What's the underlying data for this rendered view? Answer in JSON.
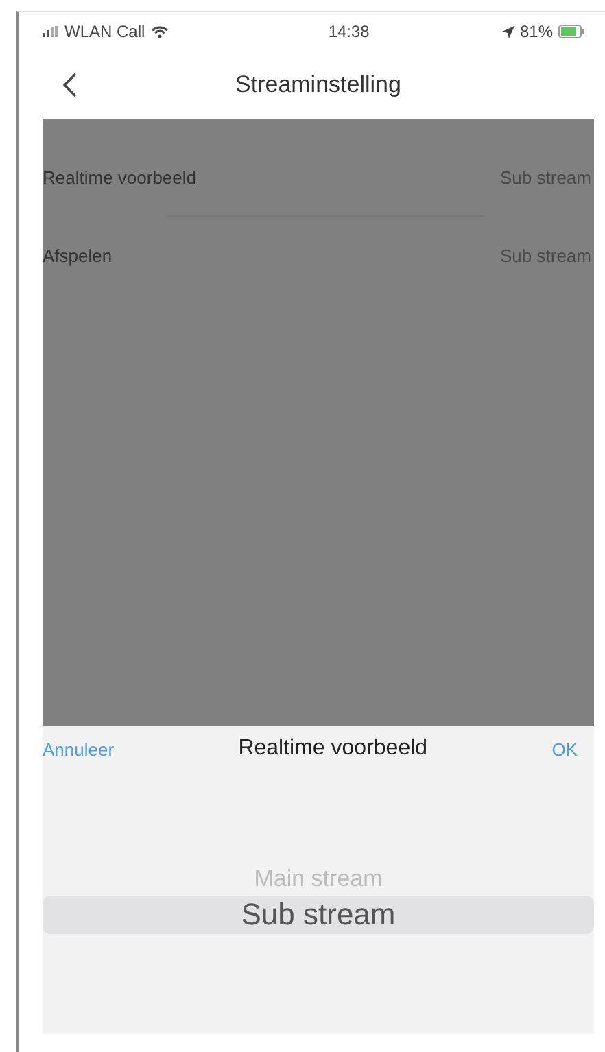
{
  "status_bar": {
    "carrier": "WLAN Call",
    "time": "14:38",
    "battery": "81%"
  },
  "nav": {
    "title": "Streaminstelling"
  },
  "settings": [
    {
      "label": "Realtime voorbeeld",
      "value": "Sub stream"
    },
    {
      "label": "Afspelen",
      "value": "Sub stream"
    }
  ],
  "picker": {
    "cancel": "Annuleer",
    "title": "Realtime voorbeeld",
    "ok": "OK",
    "options": [
      {
        "label": "Main stream",
        "selected": false
      },
      {
        "label": "Sub stream",
        "selected": true
      }
    ]
  }
}
